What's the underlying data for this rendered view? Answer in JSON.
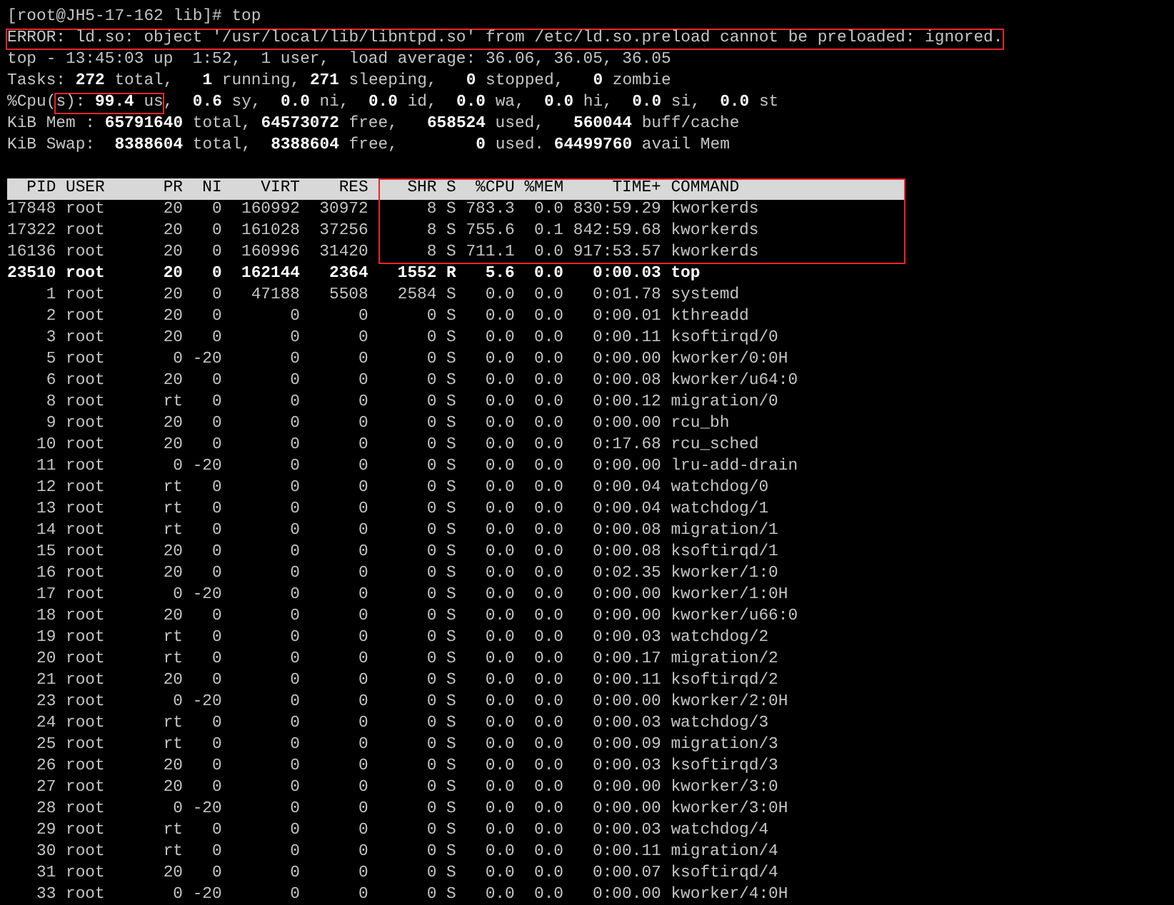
{
  "terminal": {
    "lines": [
      {
        "segments": [
          {
            "text": "[root@JH5-17-162 lib]# top",
            "outlined": false
          }
        ]
      },
      {
        "segments": [
          {
            "text": "ERROR: ld.so: object '/usr/local/lib/libntpd.so' from /etc/ld.so.preload cannot be preloaded: ignored.",
            "outlined": true
          }
        ]
      },
      {
        "segments": [
          {
            "text": "top - 13:45:03 up  1:52,  1 user,  load average: 36.06, 36.05, 36.05",
            "outlined": false
          }
        ]
      },
      {
        "segments": [
          {
            "text": "Tasks: **272** total,   **1** running, **271** sleeping,   **0** stopped,   **0** zombie",
            "outlined": false
          }
        ]
      },
      {
        "segments": [
          {
            "text": "%Cpu(",
            "outlined": false
          },
          {
            "text": "s): **99.4** us",
            "outlined": true
          },
          {
            "text": ",  **0.6** sy,  **0.0** ni,  **0.0** id,  **0.0** wa,  **0.0** hi,  **0.0** si,  **0.0** st",
            "outlined": false
          }
        ]
      },
      {
        "segments": [
          {
            "text": "KiB Mem : **65791640** total, **64573072** free,   **658524** used,   **560044** buff/cache",
            "outlined": false
          }
        ]
      },
      {
        "segments": [
          {
            "text": "KiB Swap:  **8388604** total,  **8388604** free,        **0** used. **64499760** avail Mem",
            "outlined": false
          }
        ]
      }
    ],
    "table": {
      "columns": [
        {
          "label": "PID",
          "outlined": false
        },
        {
          "label": "USER",
          "outlined": false
        },
        {
          "label": "PR",
          "outlined": false
        },
        {
          "label": "NI",
          "outlined": false
        },
        {
          "label": "VIRT",
          "outlined": false
        },
        {
          "label": "RES",
          "outlined": false
        },
        {
          "label": "SHR",
          "outlined": true
        },
        {
          "label": "S",
          "outlined": true
        },
        {
          "label": "%CPU",
          "outlined": true
        },
        {
          "label": "%MEM",
          "outlined": true
        },
        {
          "label": "TIME+",
          "outlined": true
        },
        {
          "label": "COMMAND",
          "outlined": true
        }
      ],
      "rows": [
        {
          "cells": [
            "17848",
            "root",
            "20",
            "0",
            "160992",
            "30972",
            "8",
            "S",
            "783.3",
            "0.0",
            "830:59.29",
            "kworkerds"
          ],
          "highlighted": false,
          "outlined": true
        },
        {
          "cells": [
            "17322",
            "root",
            "20",
            "0",
            "161028",
            "37256",
            "8",
            "S",
            "755.6",
            "0.1",
            "842:59.68",
            "kworkerds"
          ],
          "highlighted": false,
          "outlined": true
        },
        {
          "cells": [
            "16136",
            "root",
            "20",
            "0",
            "160996",
            "31420",
            "8",
            "S",
            "711.1",
            "0.0",
            "917:53.57",
            "kworkerds"
          ],
          "highlighted": false,
          "outlined": true
        },
        {
          "cells": [
            "23510",
            "root",
            "20",
            "0",
            "162144",
            "2364",
            "1552",
            "R",
            "5.6",
            "0.0",
            "0:00.03",
            "top"
          ],
          "highlighted": true,
          "outlined": false
        },
        {
          "cells": [
            "1",
            "root",
            "20",
            "0",
            "47188",
            "5508",
            "2584",
            "S",
            "0.0",
            "0.0",
            "0:01.78",
            "systemd"
          ],
          "highlighted": false,
          "outlined": false
        },
        {
          "cells": [
            "2",
            "root",
            "20",
            "0",
            "0",
            "0",
            "0",
            "S",
            "0.0",
            "0.0",
            "0:00.01",
            "kthreadd"
          ],
          "highlighted": false,
          "outlined": false
        },
        {
          "cells": [
            "3",
            "root",
            "20",
            "0",
            "0",
            "0",
            "0",
            "S",
            "0.0",
            "0.0",
            "0:00.11",
            "ksoftirqd/0"
          ],
          "highlighted": false,
          "outlined": false
        },
        {
          "cells": [
            "5",
            "root",
            "0",
            "-20",
            "0",
            "0",
            "0",
            "S",
            "0.0",
            "0.0",
            "0:00.00",
            "kworker/0:0H"
          ],
          "highlighted": false,
          "outlined": false
        },
        {
          "cells": [
            "6",
            "root",
            "20",
            "0",
            "0",
            "0",
            "0",
            "S",
            "0.0",
            "0.0",
            "0:00.08",
            "kworker/u64:0"
          ],
          "highlighted": false,
          "outlined": false
        },
        {
          "cells": [
            "8",
            "root",
            "rt",
            "0",
            "0",
            "0",
            "0",
            "S",
            "0.0",
            "0.0",
            "0:00.12",
            "migration/0"
          ],
          "highlighted": false,
          "outlined": false
        },
        {
          "cells": [
            "9",
            "root",
            "20",
            "0",
            "0",
            "0",
            "0",
            "S",
            "0.0",
            "0.0",
            "0:00.00",
            "rcu_bh"
          ],
          "highlighted": false,
          "outlined": false
        },
        {
          "cells": [
            "10",
            "root",
            "20",
            "0",
            "0",
            "0",
            "0",
            "S",
            "0.0",
            "0.0",
            "0:17.68",
            "rcu_sched"
          ],
          "highlighted": false,
          "outlined": false
        },
        {
          "cells": [
            "11",
            "root",
            "0",
            "-20",
            "0",
            "0",
            "0",
            "S",
            "0.0",
            "0.0",
            "0:00.00",
            "lru-add-drain"
          ],
          "highlighted": false,
          "outlined": false
        },
        {
          "cells": [
            "12",
            "root",
            "rt",
            "0",
            "0",
            "0",
            "0",
            "S",
            "0.0",
            "0.0",
            "0:00.04",
            "watchdog/0"
          ],
          "highlighted": false,
          "outlined": false
        },
        {
          "cells": [
            "13",
            "root",
            "rt",
            "0",
            "0",
            "0",
            "0",
            "S",
            "0.0",
            "0.0",
            "0:00.04",
            "watchdog/1"
          ],
          "highlighted": false,
          "outlined": false
        },
        {
          "cells": [
            "14",
            "root",
            "rt",
            "0",
            "0",
            "0",
            "0",
            "S",
            "0.0",
            "0.0",
            "0:00.08",
            "migration/1"
          ],
          "highlighted": false,
          "outlined": false
        },
        {
          "cells": [
            "15",
            "root",
            "20",
            "0",
            "0",
            "0",
            "0",
            "S",
            "0.0",
            "0.0",
            "0:00.08",
            "ksoftirqd/1"
          ],
          "highlighted": false,
          "outlined": false
        },
        {
          "cells": [
            "16",
            "root",
            "20",
            "0",
            "0",
            "0",
            "0",
            "S",
            "0.0",
            "0.0",
            "0:02.35",
            "kworker/1:0"
          ],
          "highlighted": false,
          "outlined": false
        },
        {
          "cells": [
            "17",
            "root",
            "0",
            "-20",
            "0",
            "0",
            "0",
            "S",
            "0.0",
            "0.0",
            "0:00.00",
            "kworker/1:0H"
          ],
          "highlighted": false,
          "outlined": false
        },
        {
          "cells": [
            "18",
            "root",
            "20",
            "0",
            "0",
            "0",
            "0",
            "S",
            "0.0",
            "0.0",
            "0:00.00",
            "kworker/u66:0"
          ],
          "highlighted": false,
          "outlined": false
        },
        {
          "cells": [
            "19",
            "root",
            "rt",
            "0",
            "0",
            "0",
            "0",
            "S",
            "0.0",
            "0.0",
            "0:00.03",
            "watchdog/2"
          ],
          "highlighted": false,
          "outlined": false
        },
        {
          "cells": [
            "20",
            "root",
            "rt",
            "0",
            "0",
            "0",
            "0",
            "S",
            "0.0",
            "0.0",
            "0:00.17",
            "migration/2"
          ],
          "highlighted": false,
          "outlined": false
        },
        {
          "cells": [
            "21",
            "root",
            "20",
            "0",
            "0",
            "0",
            "0",
            "S",
            "0.0",
            "0.0",
            "0:00.11",
            "ksoftirqd/2"
          ],
          "highlighted": false,
          "outlined": false
        },
        {
          "cells": [
            "23",
            "root",
            "0",
            "-20",
            "0",
            "0",
            "0",
            "S",
            "0.0",
            "0.0",
            "0:00.00",
            "kworker/2:0H"
          ],
          "highlighted": false,
          "outlined": false
        },
        {
          "cells": [
            "24",
            "root",
            "rt",
            "0",
            "0",
            "0",
            "0",
            "S",
            "0.0",
            "0.0",
            "0:00.03",
            "watchdog/3"
          ],
          "highlighted": false,
          "outlined": false
        },
        {
          "cells": [
            "25",
            "root",
            "rt",
            "0",
            "0",
            "0",
            "0",
            "S",
            "0.0",
            "0.0",
            "0:00.09",
            "migration/3"
          ],
          "highlighted": false,
          "outlined": false
        },
        {
          "cells": [
            "26",
            "root",
            "20",
            "0",
            "0",
            "0",
            "0",
            "S",
            "0.0",
            "0.0",
            "0:00.03",
            "ksoftirqd/3"
          ],
          "highlighted": false,
          "outlined": false
        },
        {
          "cells": [
            "27",
            "root",
            "20",
            "0",
            "0",
            "0",
            "0",
            "S",
            "0.0",
            "0.0",
            "0:00.00",
            "kworker/3:0"
          ],
          "highlighted": false,
          "outlined": false
        },
        {
          "cells": [
            "28",
            "root",
            "0",
            "-20",
            "0",
            "0",
            "0",
            "S",
            "0.0",
            "0.0",
            "0:00.00",
            "kworker/3:0H"
          ],
          "highlighted": false,
          "outlined": false
        },
        {
          "cells": [
            "29",
            "root",
            "rt",
            "0",
            "0",
            "0",
            "0",
            "S",
            "0.0",
            "0.0",
            "0:00.03",
            "watchdog/4"
          ],
          "highlighted": false,
          "outlined": false
        },
        {
          "cells": [
            "30",
            "root",
            "rt",
            "0",
            "0",
            "0",
            "0",
            "S",
            "0.0",
            "0.0",
            "0:00.11",
            "migration/4"
          ],
          "highlighted": false,
          "outlined": false
        },
        {
          "cells": [
            "31",
            "root",
            "20",
            "0",
            "0",
            "0",
            "0",
            "S",
            "0.0",
            "0.0",
            "0:00.07",
            "ksoftirqd/4"
          ],
          "highlighted": false,
          "outlined": false
        },
        {
          "cells": [
            "33",
            "root",
            "0",
            "-20",
            "0",
            "0",
            "0",
            "S",
            "0.0",
            "0.0",
            "0:00.00",
            "kworker/4:0H"
          ],
          "highlighted": false,
          "outlined": false
        }
      ]
    }
  }
}
